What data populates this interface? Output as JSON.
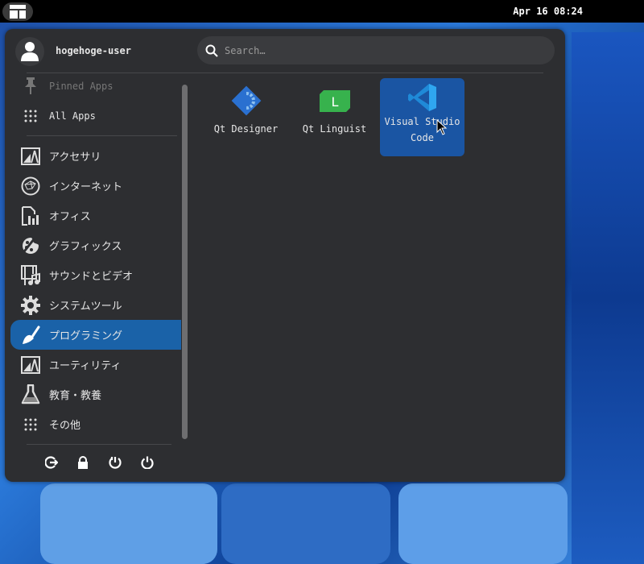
{
  "topbar": {
    "clock": "Apr 16 08:24"
  },
  "user": {
    "name": "hogehoge-user"
  },
  "search": {
    "placeholder": "Search…"
  },
  "sidebar": {
    "items": [
      {
        "label": "Pinned Apps",
        "icon": "pin-icon"
      },
      {
        "label": "All Apps",
        "icon": "grid-icon"
      },
      {
        "label": "アクセサリ",
        "icon": "accessories-icon"
      },
      {
        "label": "インターネット",
        "icon": "globe-icon"
      },
      {
        "label": "オフィス",
        "icon": "office-icon"
      },
      {
        "label": "グラフィックス",
        "icon": "palette-icon"
      },
      {
        "label": "サウンドとビデオ",
        "icon": "multimedia-icon"
      },
      {
        "label": "システムツール",
        "icon": "gear-icon"
      },
      {
        "label": "プログラミング",
        "icon": "trowel-icon"
      },
      {
        "label": "ユーティリティ",
        "icon": "utilities-icon"
      },
      {
        "label": "教育・教養",
        "icon": "flask-icon"
      },
      {
        "label": "その他",
        "icon": "grid-icon"
      }
    ]
  },
  "apps": [
    {
      "label": "Qt Designer"
    },
    {
      "label": "Qt Linguist",
      "icon_letter": "L"
    },
    {
      "label": "Visual Studio Code"
    }
  ],
  "colors": {
    "accent": "#1a62a8",
    "panel": "#2d2e31"
  }
}
